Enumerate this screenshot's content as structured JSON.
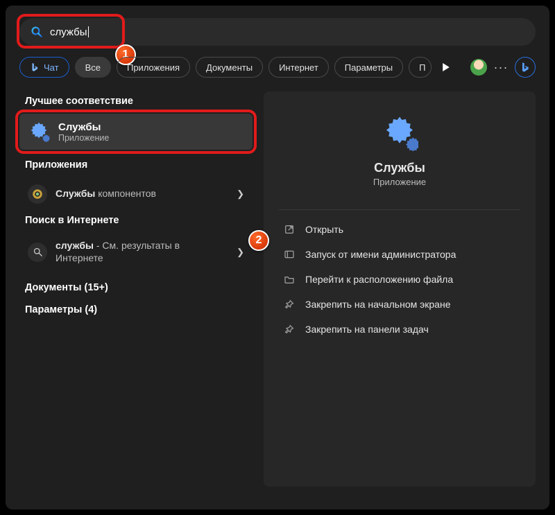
{
  "search": {
    "query": "службы"
  },
  "chips": {
    "chat": "Чат",
    "all": "Все",
    "apps": "Приложения",
    "docs": "Документы",
    "web": "Интернет",
    "settings": "Параметры",
    "truncated": "П"
  },
  "left": {
    "best_match_header": "Лучшее соответствие",
    "best_match": {
      "title": "Службы",
      "sub": "Приложение"
    },
    "apps_header": "Приложения",
    "apps_item": {
      "bold": "Службы",
      "rest": " компонентов"
    },
    "web_header": "Поиск в Интернете",
    "web_item": {
      "bold": "службы",
      "rest": " - См. результаты в Интернете"
    },
    "docs_header": "Документы (15+)",
    "settings_header": "Параметры (4)"
  },
  "right": {
    "title": "Службы",
    "sub": "Приложение",
    "actions": {
      "open": "Открыть",
      "admin": "Запуск от имени администратора",
      "location": "Перейти к расположению файла",
      "pin_start": "Закрепить на начальном экране",
      "pin_taskbar": "Закрепить на панели задач"
    }
  },
  "badges": {
    "one": "1",
    "two": "2"
  }
}
